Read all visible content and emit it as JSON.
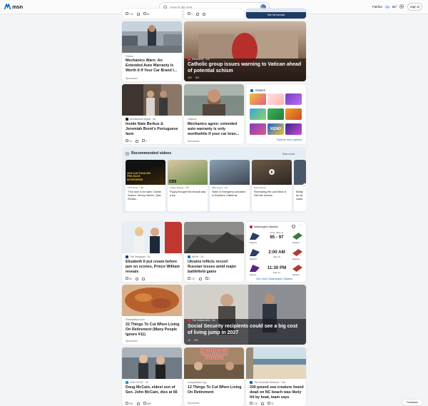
{
  "header": {
    "logo_text": "msn",
    "search_placeholder": "Search the web",
    "location": "Fairfax",
    "temperature": "65°",
    "signin_label": "Sign in"
  },
  "top_strip": {
    "reacts_left": [
      "744",
      "86"
    ],
    "reacts_mid": [
      "4"
    ],
    "see_full_forecast": "See full forecast"
  },
  "cards": {
    "mechanics_warn": {
      "source": "Forbes",
      "title": "Mechanics Warn: An Extended Auto Warranty Is Worth It If Your Car Brand I...",
      "sponsored": "Sponsored"
    },
    "catholic": {
      "source": "Newsweek · 14h",
      "title": "Catholic group issues warning to Vatican ahead of potential schism",
      "reacts": [
        "403",
        "361"
      ]
    },
    "berkus": {
      "source": "Architectural Digest · 6d",
      "title": "Inside Nate Berkus & Jeremiah Brent’s Portuguese farm",
      "reacts": [
        "24",
        "3"
      ]
    },
    "mechanics_agree": {
      "source": "Carbuzz",
      "title": "Mechanics agree: extended auto warranty is only worthwhile if your car bran...",
      "sponsored": "Sponsored"
    },
    "cream": {
      "source": "The Telegraph · 1d",
      "title": "Elizabeth II put cream before jam on scones, Prince William reveals",
      "reacts": [
        "86"
      ]
    },
    "ukraine": {
      "source": "WION · 3h",
      "title": "Ukraine inflicts record Russian losses amid major battlefield gains",
      "reacts": [
        "137",
        "2"
      ]
    },
    "things_cut": {
      "source": "FinanceBuzz.com",
      "title": "22 Things To Cut When Living On Retirement (Many People Ignore #11)",
      "sponsored": "Sponsored"
    },
    "social_security": {
      "source": "The Independent · 5d",
      "title": "Social Security recipients could see a big cost of living jump in 2027",
      "reacts": [
        "26",
        "309"
      ]
    },
    "mccain": {
      "source": "USA TODAY · 2h",
      "title": "Doug McCain, eldest son of Sen. John McCain, dies at 66",
      "reacts": [
        "491",
        "288"
      ]
    },
    "twelve_things": {
      "source": "Comparisons.org",
      "title": "12 Things To Cut When Living On Retirement",
      "sponsored": "Sponsored",
      "image_text": "12 Things to Cut When Living On Retirement"
    },
    "sea_creature": {
      "source": "The Charlotte Observer · 23h",
      "title": "200-pound sea creature found dead on NC beach was likely hit by boat, team says",
      "reacts": [
        "178",
        "78"
      ]
    }
  },
  "games": {
    "heading": "Games",
    "explore": "Explore more games",
    "keno": "KENO"
  },
  "videos": {
    "heading": "Recommended videos",
    "see_more": "See more",
    "items": [
      {
        "source": "FOX News · 19h",
        "title": "'This race is for style,' Daniel Suárez, Denny Hamlin, Tyler Reddic...",
        "thumb_text": "2026 DAYTONA 500 PRE-RACE INTERVIEWS"
      },
      {
        "source": "Insider Budget · 22h",
        "title": "Puppy thought this shrank was a toy",
        "duration": "00:10"
      },
      {
        "source": "NBC News · 12h",
        "title": "State of emergency declared in Southern California"
      },
      {
        "source": "Daily Nature",
        "title": "Recreating the Last Meal of Ötzi the Iceman"
      },
      {
        "source": "",
        "title": "Multip by rar coast"
      }
    ]
  },
  "sports": {
    "team": "Washington Mystics",
    "games": [
      {
        "status": "Final · May 27",
        "score": "85 - 97",
        "home": "Mystics",
        "away": "Mystics"
      },
      {
        "status": "May 29",
        "score": "2:00 AM",
        "home": "Mystics",
        "away": "Mystics"
      },
      {
        "status": "May 31",
        "score": "11:30 PM",
        "home": "Sparks",
        "away": "Mystics"
      }
    ],
    "see_more": "See more Washington Mystics"
  },
  "feedback": "Feedback",
  "colors": {
    "accent": "#0f6cbd",
    "red": "#d13438",
    "bg": "#f3f4f6"
  }
}
